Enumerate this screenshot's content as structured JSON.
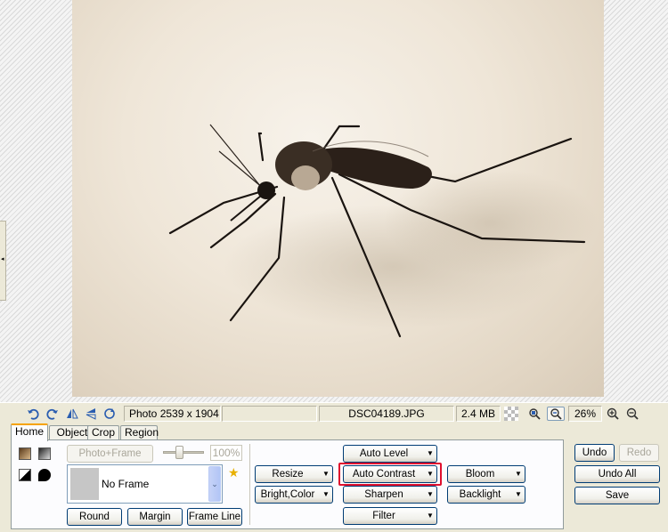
{
  "status_bar": {
    "photo_info": "Photo 2539 x 1904",
    "file_name": "DSC04189.JPG",
    "file_size": "2.4 MB",
    "zoom_level": "26%",
    "icons": [
      "undo-arrow-icon",
      "redo-arrow-icon",
      "flip-horizontal-icon",
      "flip-vertical-icon",
      "rotate-icon",
      "transparency-icon",
      "zoom-fit-icon",
      "zoom-actual-icon",
      "zoom-in-icon",
      "zoom-out-icon"
    ]
  },
  "tabs": [
    {
      "label": "Home",
      "active": true
    },
    {
      "label": "Object",
      "active": false
    },
    {
      "label": "Crop",
      "active": false
    },
    {
      "label": "Region",
      "active": false
    }
  ],
  "frame_tools": {
    "photo_frame_label": "Photo+Frame",
    "opacity_value": "100%",
    "frame_selected": "No Frame",
    "round_label": "Round",
    "margin_label": "Margin",
    "frame_line_label": "Frame Line"
  },
  "adjust_tools": {
    "resize": "Resize",
    "bright_color": "Bright,Color",
    "auto_level": "Auto Level",
    "auto_contrast": "Auto Contrast",
    "sharpen": "Sharpen",
    "filter": "Filter",
    "bloom": "Bloom",
    "backlight": "Backlight"
  },
  "history": {
    "undo": "Undo",
    "redo": "Redo",
    "undo_all": "Undo All",
    "save": "Save"
  },
  "colors": {
    "highlight": "#e0102e",
    "tab_accent": "#f6a300",
    "button_border": "#003c74"
  }
}
